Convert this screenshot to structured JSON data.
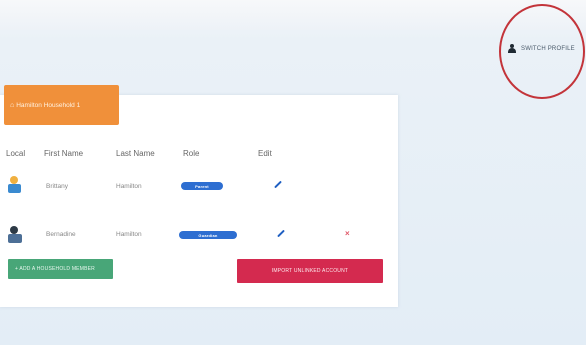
{
  "header": {
    "switch_profile_label": "SWITCH PROFILE"
  },
  "account": {
    "button_label": "Hamilton Household 1",
    "icon": "home-icon"
  },
  "table": {
    "columns": [
      "Local",
      "First Name",
      "Last Name",
      "Role",
      "Edit"
    ],
    "rows": [
      {
        "first_name": "Brittany",
        "last_name": "Hamilton",
        "role": "Parent",
        "avatar": "person-avatar"
      },
      {
        "first_name": "Bernadine",
        "last_name": "Hamilton",
        "role": "Guardian",
        "avatar": "person-avatar"
      }
    ]
  },
  "actions": {
    "add_label": "+ ADD A HOUSEHOLD MEMBER",
    "import_label": "IMPORT UNLINKED ACCOUNT"
  },
  "colors": {
    "account_button": "#f0903a",
    "badge": "#2d6ed1",
    "add_button": "#48a678",
    "import_button": "#d42a4f",
    "highlight_circle": "#c3343a"
  }
}
